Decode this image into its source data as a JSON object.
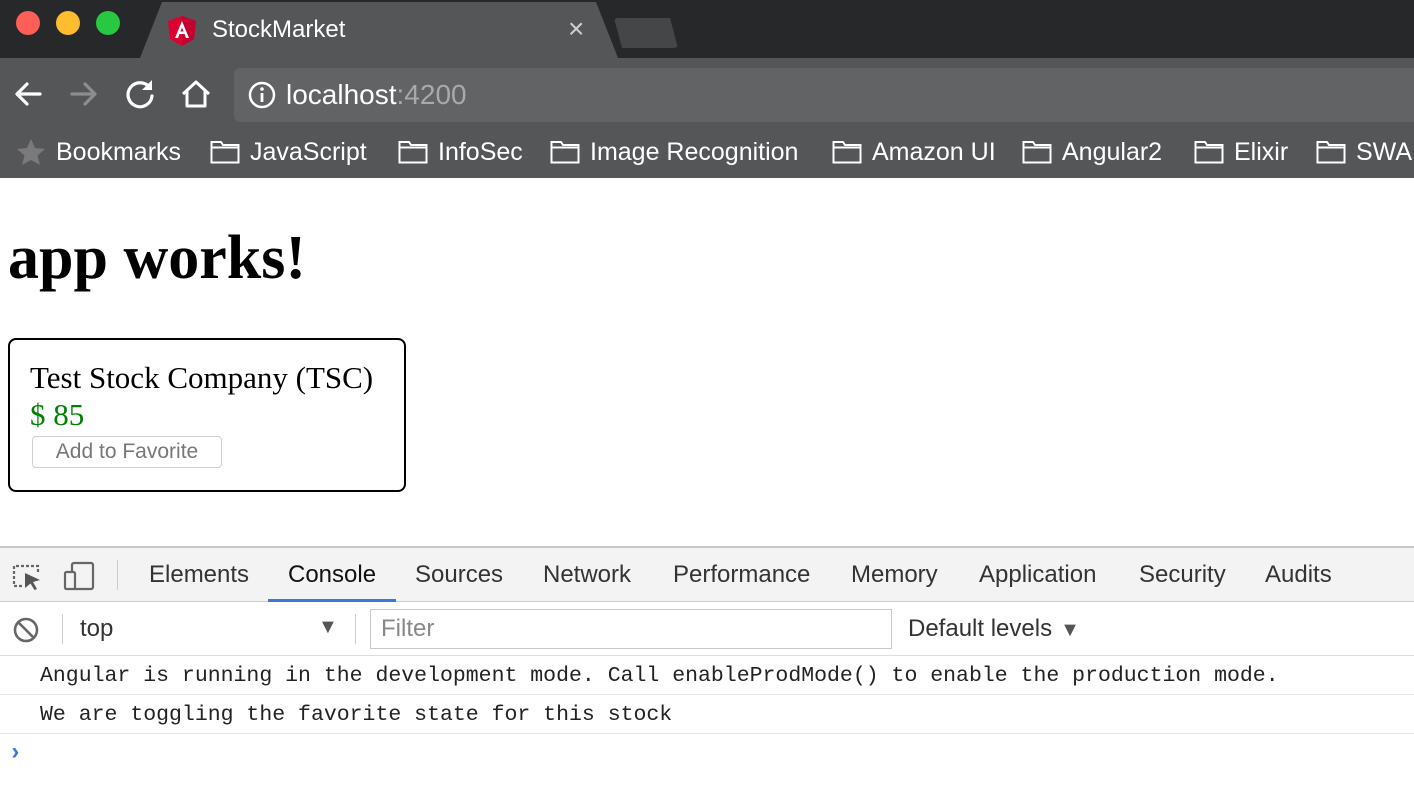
{
  "browser": {
    "tab_title": "StockMarket",
    "tab_close": "×",
    "url_host": "localhost",
    "url_port": ":4200",
    "bookmarks": [
      "Bookmarks",
      "JavaScript",
      "InfoSec",
      "Image Recognition",
      "Amazon UI",
      "Angular2",
      "Elixir",
      "SWA"
    ]
  },
  "page": {
    "heading": "app works!",
    "stock": {
      "name": "Test Stock Company (TSC)",
      "price": "$ 85",
      "button_label": "Add to Favorite"
    }
  },
  "devtools": {
    "tabs": [
      "Elements",
      "Console",
      "Sources",
      "Network",
      "Performance",
      "Memory",
      "Application",
      "Security",
      "Audits"
    ],
    "active_tab": "Console",
    "context": "top",
    "filter_placeholder": "Filter",
    "levels_label": "Default levels",
    "messages": [
      "Angular is running in the development mode. Call enableProdMode() to enable the production mode.",
      "We are toggling the favorite state for this stock"
    ],
    "prompt": "›"
  },
  "colors": {
    "price": "#008000",
    "accent": "#3879d9",
    "angular_red": "#dd0031"
  },
  "icons": [
    "angular-logo-icon",
    "back-arrow-icon",
    "forward-arrow-icon",
    "reload-icon",
    "home-icon",
    "info-icon",
    "star-icon",
    "folder-icon",
    "inspect-icon",
    "device-icon",
    "clear-console-icon"
  ]
}
